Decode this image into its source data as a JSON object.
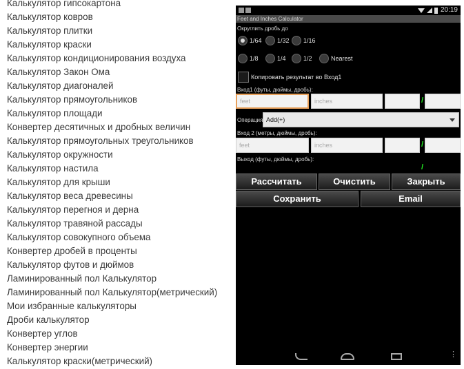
{
  "calculator_list": [
    "Калькулятор гипсокартона",
    "Калькулятор ковров",
    "Калькулятор плитки",
    "Калькулятор краски",
    "Калькулятор кондиционирования воздуха",
    "Калькулятор Закон Ома",
    "Калькулятор диагоналей",
    "Калькулятор прямоугольников",
    "Калькулятор площади",
    "Конвертер десятичных и дробных величин",
    "Калькулятор прямоугольных треугольников",
    "Калькулятор окружности",
    "Калькулятор настила",
    "Калькулятор для крыши",
    "Калькулятор веса древесины",
    "Калькулятор перегноя и дерна",
    "Калькулятор травяной рассады",
    "Калькулятор совокупного объема",
    "Конвертер дробей в проценты",
    "Калькулятор футов и дюймов",
    "Ламинированный пол Калькулятор",
    "Ламинированный пол Калькулятор(метрический)",
    "Мои избранные калькуляторы",
    "Дроби калькулятор",
    "Конвертер углов",
    "Конвертер энергии",
    "Калькулятор краски(метрический)"
  ],
  "phone": {
    "status_time": "20:19",
    "app_title": "Feet and Inches Calculator",
    "round_label": "Округлить дробь до",
    "round_options": [
      {
        "label": "1/64",
        "checked": true
      },
      {
        "label": "1/32",
        "checked": false
      },
      {
        "label": "1/16",
        "checked": false
      },
      {
        "label": "1/8",
        "checked": false
      },
      {
        "label": "1/4",
        "checked": false
      },
      {
        "label": "1/2",
        "checked": false
      },
      {
        "label": "Nearest",
        "checked": false
      }
    ],
    "copy_result_label": "Копировать результат во Вход1",
    "input1_label": "Вход1 (футы, дюймы, дробь):",
    "input1": {
      "feet_placeholder": "feet",
      "inches_placeholder": "inches",
      "slash": "/"
    },
    "operation_label": "Операция:",
    "operation_value": "Add(+)",
    "input2_label": "Вход 2 (метры, дюймы, дробь):",
    "input2": {
      "feet_placeholder": "feet",
      "inches_placeholder": "inches",
      "slash": "/"
    },
    "output_label": "Выход (футы, дюймы, дробь):",
    "output_slash": "/",
    "buttons": {
      "calculate": "Рассчитать",
      "clear": "Очистить",
      "close": "Закрыть",
      "save": "Сохранить",
      "email": "Email"
    }
  }
}
